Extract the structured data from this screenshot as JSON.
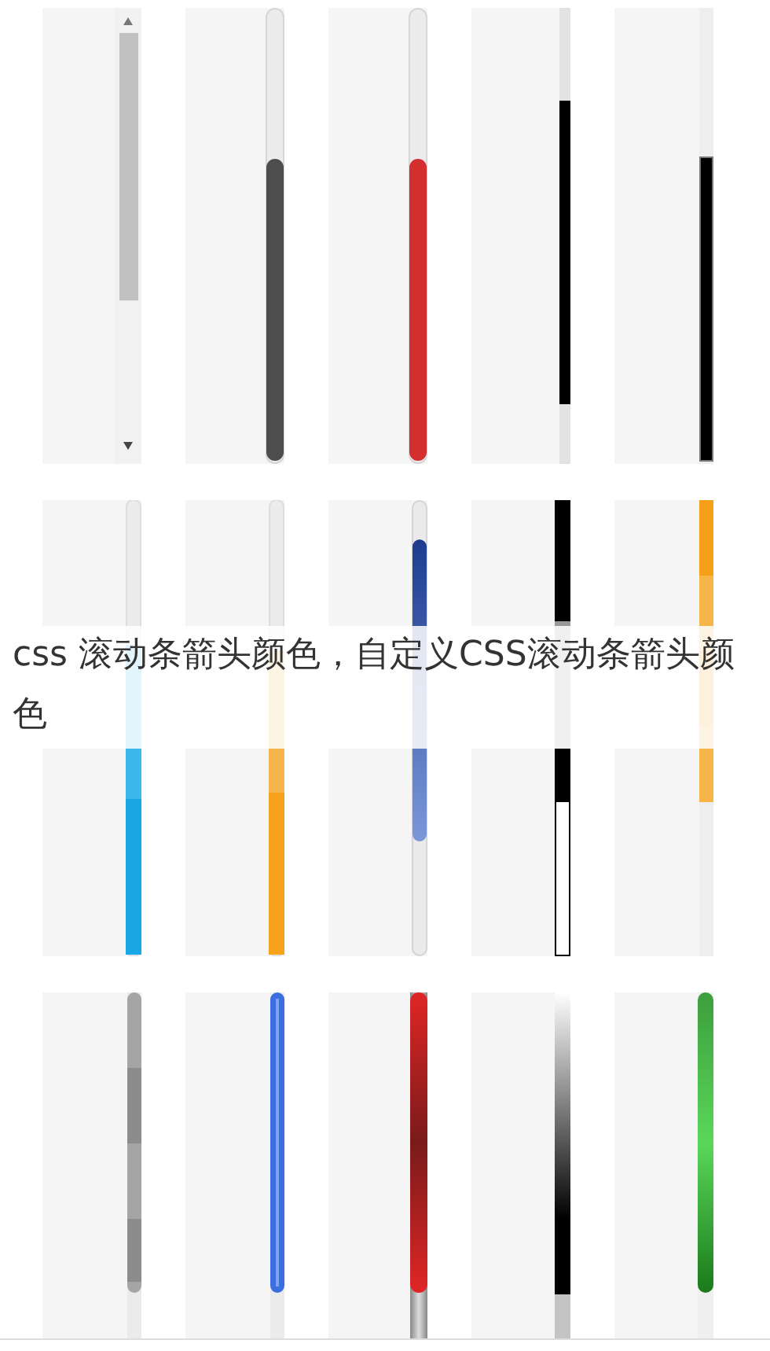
{
  "caption": "css 滚动条箭头颜色，自定义CSS滚动条箭头颜色"
}
